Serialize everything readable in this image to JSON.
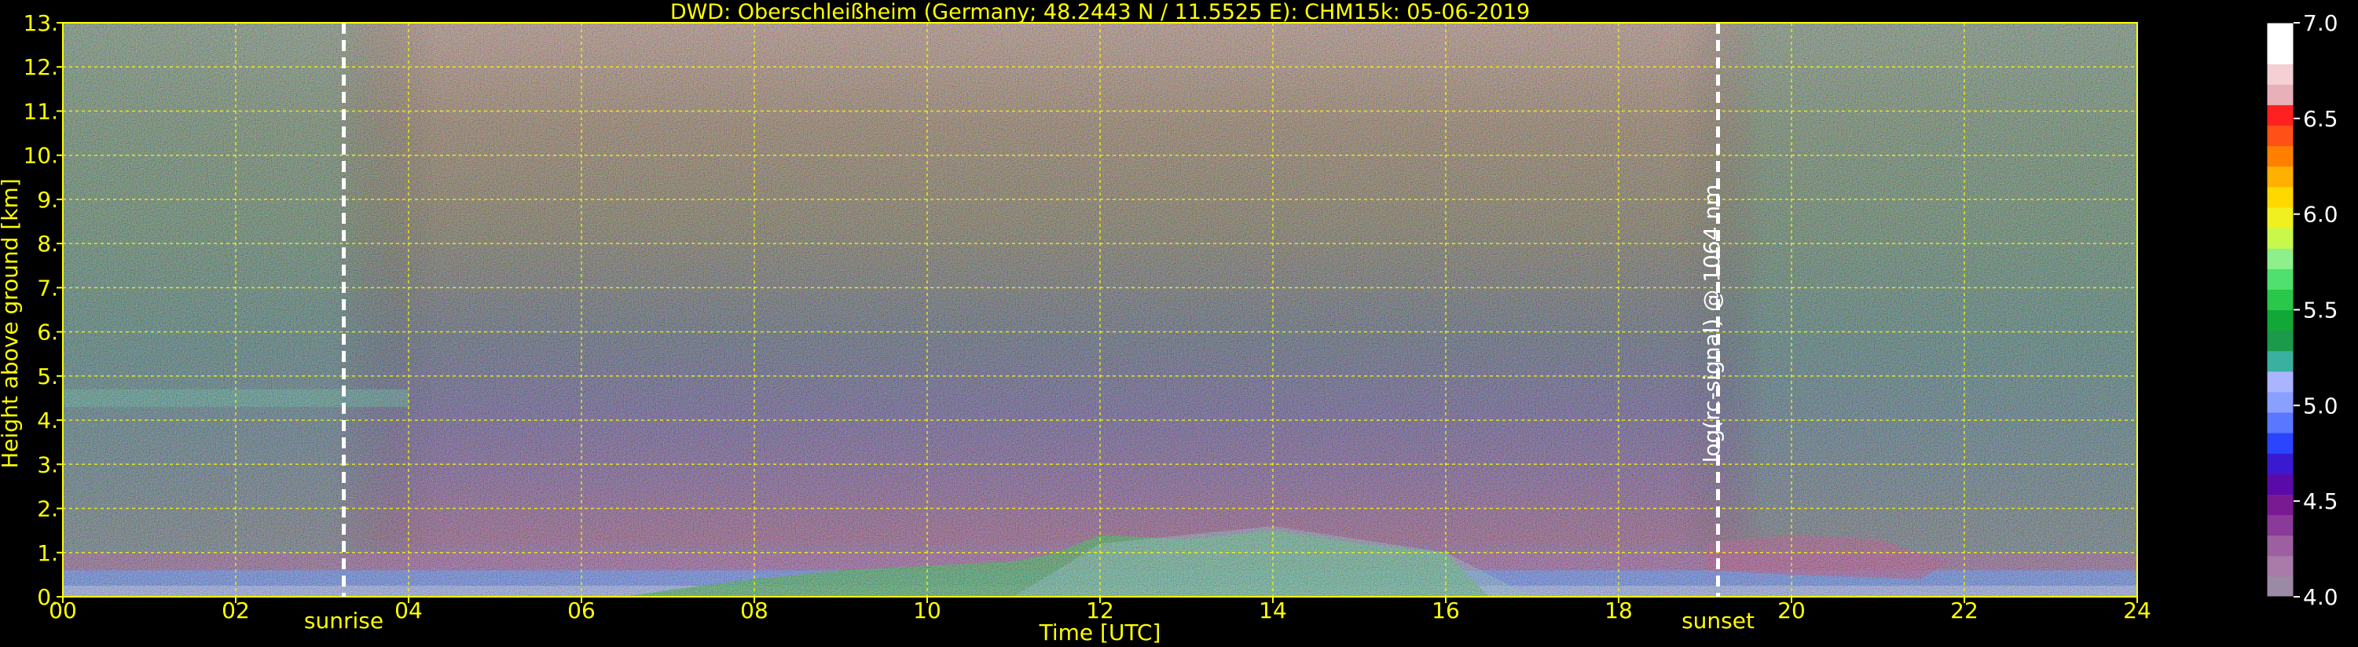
{
  "chart_data": {
    "type": "heatmap",
    "title": "DWD: Oberschleißheim (Germany; 48.2443 N / 11.5525 E):    CHM15k: 05-06-2019",
    "xlabel": "Time [UTC]",
    "ylabel": "Height above ground [km]",
    "xlim": [
      0,
      24
    ],
    "ylim": [
      0,
      13
    ],
    "x_ticks": [
      {
        "value": 0,
        "label": "00"
      },
      {
        "value": 2,
        "label": "02"
      },
      {
        "value": 4,
        "label": "04"
      },
      {
        "value": 6,
        "label": "06"
      },
      {
        "value": 8,
        "label": "08"
      },
      {
        "value": 10,
        "label": "10"
      },
      {
        "value": 12,
        "label": "12"
      },
      {
        "value": 14,
        "label": "14"
      },
      {
        "value": 16,
        "label": "16"
      },
      {
        "value": 18,
        "label": "18"
      },
      {
        "value": 20,
        "label": "20"
      },
      {
        "value": 22,
        "label": "22"
      },
      {
        "value": 24,
        "label": "24"
      }
    ],
    "y_ticks": [
      {
        "value": 0,
        "label": "0."
      },
      {
        "value": 1,
        "label": "1."
      },
      {
        "value": 2,
        "label": "2."
      },
      {
        "value": 3,
        "label": "3."
      },
      {
        "value": 4,
        "label": "4."
      },
      {
        "value": 5,
        "label": "5."
      },
      {
        "value": 6,
        "label": "6."
      },
      {
        "value": 7,
        "label": "7."
      },
      {
        "value": 8,
        "label": "8."
      },
      {
        "value": 9,
        "label": "9."
      },
      {
        "value": 10,
        "label": "10."
      },
      {
        "value": 11,
        "label": "11."
      },
      {
        "value": 12,
        "label": "12."
      },
      {
        "value": 13,
        "label": "13."
      }
    ],
    "grid": true,
    "colorbar": {
      "label": "log(rc-signal) @ 1064 nm",
      "range": [
        4.0,
        7.0
      ],
      "ticks": [
        {
          "value": 4.0,
          "label": "4.0"
        },
        {
          "value": 4.5,
          "label": "4.5"
        },
        {
          "value": 5.0,
          "label": "5.0"
        },
        {
          "value": 5.5,
          "label": "5.5"
        },
        {
          "value": 6.0,
          "label": "6.0"
        },
        {
          "value": 6.5,
          "label": "6.5"
        },
        {
          "value": 7.0,
          "label": "7.0"
        }
      ],
      "colors": [
        "#9a8aa6",
        "#a87ba8",
        "#9c5fa0",
        "#8a3a98",
        "#7a1a92",
        "#5a0aa8",
        "#3a1ad0",
        "#2a44ff",
        "#5a78ff",
        "#8aa0ff",
        "#aab4ff",
        "#3ab0a0",
        "#1a9a4a",
        "#12a838",
        "#2ac84a",
        "#50e070",
        "#8ef08a",
        "#c8f84a",
        "#f0f020",
        "#ffd800",
        "#ffb000",
        "#ff8000",
        "#ff5018",
        "#ff2020",
        "#e8b0b8",
        "#f4d0d4",
        "#ffffff",
        "#ffffff"
      ]
    },
    "markers": [
      {
        "name": "sunrise",
        "x": 3.25
      },
      {
        "name": "sunset",
        "x": 19.15
      }
    ]
  }
}
